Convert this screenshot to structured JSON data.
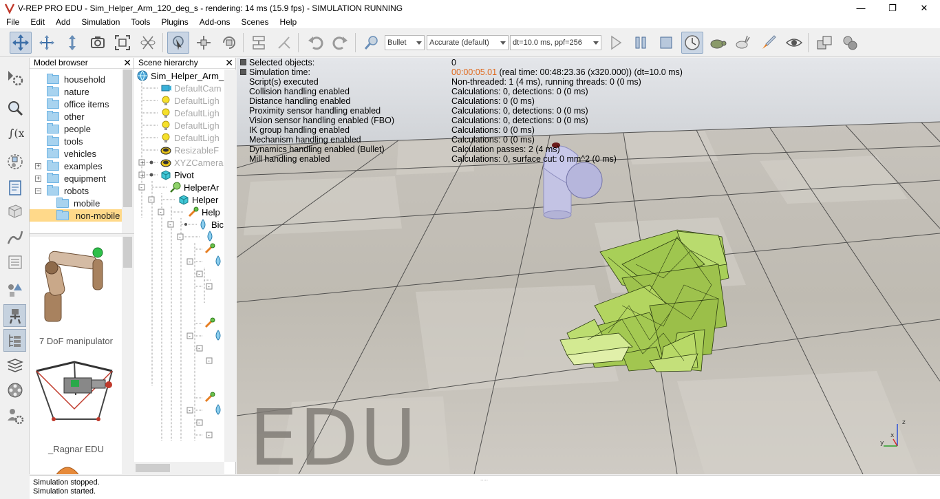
{
  "window": {
    "title": "V-REP PRO EDU - Sim_Helper_Arm_120_deg_s - rendering: 14 ms (15.9 fps) - SIMULATION RUNNING",
    "minimize_glyph": "—",
    "maximize_glyph": "❐",
    "close_glyph": "✕"
  },
  "menu": [
    "File",
    "Edit",
    "Add",
    "Simulation",
    "Tools",
    "Plugins",
    "Add-ons",
    "Scenes",
    "Help"
  ],
  "toolbar": {
    "engine": "Bullet",
    "accuracy": "Accurate (default)",
    "timestep": "dt=10.0 ms, ppf=256",
    "icons": [
      "camera-pan-icon",
      "camera-rotate-icon",
      "camera-shift-icon",
      "camera-angle-icon",
      "fit-to-view-icon",
      "manipulator-mode-icon",
      "click-selection-icon",
      "object-shift-icon",
      "object-rotate-icon",
      "assemble-icon",
      "transfer-dna-icon",
      "undo-icon",
      "redo-icon",
      "dynamic-content-icon",
      "start-simulation-icon",
      "pause-simulation-icon",
      "stop-simulation-icon",
      "real-time-icon",
      "slow-down-icon",
      "speed-up-icon",
      "thread-rendering-icon",
      "visualization-toggle-icon",
      "page-selector-icon",
      "scene-selector-icon"
    ]
  },
  "model_browser": {
    "title": "Model browser",
    "close": "✕",
    "folders": [
      {
        "label": "household",
        "expandable": false
      },
      {
        "label": "nature",
        "expandable": false
      },
      {
        "label": "office items",
        "expandable": false
      },
      {
        "label": "other",
        "expandable": false
      },
      {
        "label": "people",
        "expandable": false
      },
      {
        "label": "tools",
        "expandable": false
      },
      {
        "label": "vehicles",
        "expandable": false
      },
      {
        "label": "examples",
        "expandable": true
      },
      {
        "label": "equipment",
        "expandable": true
      },
      {
        "label": "robots",
        "expandable": true,
        "expanded": true
      },
      {
        "label": "mobile",
        "expandable": false,
        "child": true
      },
      {
        "label": "non-mobile",
        "expandable": false,
        "child": true,
        "selected": true
      }
    ],
    "models": [
      {
        "caption": "7 DoF manipulator"
      },
      {
        "caption": "_Ragnar EDU"
      }
    ]
  },
  "scene_hierarchy": {
    "title": "Scene hierarchy",
    "close": "✕",
    "items": [
      {
        "label": "Sim_Helper_Arm_",
        "icon": "scene-icon",
        "grey": false
      },
      {
        "label": "DefaultCam",
        "icon": "camera-icon",
        "grey": true
      },
      {
        "label": "DefaultLigh",
        "icon": "light-icon",
        "grey": true
      },
      {
        "label": "DefaultLigh",
        "icon": "light-icon",
        "grey": true
      },
      {
        "label": "DefaultLigh",
        "icon": "light-icon",
        "grey": true
      },
      {
        "label": "DefaultLigh",
        "icon": "light-icon",
        "grey": true
      },
      {
        "label": "ResizableF",
        "icon": "model-icon",
        "grey": true
      },
      {
        "label": "XYZCamera",
        "icon": "model-icon",
        "grey": true
      },
      {
        "label": "Pivot",
        "icon": "shape-icon",
        "grey": false
      },
      {
        "label": "HelperAr",
        "icon": "joint-icon",
        "grey": false
      },
      {
        "label": "Helper",
        "icon": "shape-icon",
        "grey": false
      },
      {
        "label": "Help",
        "icon": "force-sensor-icon",
        "grey": false
      },
      {
        "label": "Bic",
        "icon": "dummy-icon",
        "grey": false
      }
    ]
  },
  "sim_info": {
    "rows": [
      {
        "label": "Selected objects:",
        "value": "0"
      },
      {
        "label": "Simulation time:",
        "value_highlight": "00:00:05.01",
        "value": " (real time: 00:48:23.36 (x320.000)) (dt=10.0 ms)"
      },
      {
        "label": "Script(s) executed",
        "value": "Non-threaded: 1 (4 ms), running threads: 0 (0 ms)"
      },
      {
        "label": "Collision handling enabled",
        "value": "Calculations: 0, detections: 0 (0 ms)"
      },
      {
        "label": "Distance handling enabled",
        "value": "Calculations: 0 (0 ms)"
      },
      {
        "label": "Proximity sensor handling enabled",
        "value": "Calculations: 0, detections: 0 (0 ms)"
      },
      {
        "label": "Vision sensor handling enabled (FBO)",
        "value": "Calculations: 0, detections: 0 (0 ms)"
      },
      {
        "label": "IK group handling enabled",
        "value": "Calculations: 0 (0 ms)"
      },
      {
        "label": "Mechanism handling enabled",
        "value": "Calculations: 0 (0 ms)"
      },
      {
        "label": "Dynamics handling enabled (Bullet)",
        "value": "Calculation passes: 2 (4 ms)"
      },
      {
        "label": "Mill handling enabled",
        "value": "Calculations: 0, surface cut: 0 mm^2 (0 ms)"
      }
    ]
  },
  "watermark": "EDU",
  "axes": {
    "x": "x",
    "y": "y",
    "z": "z"
  },
  "status": {
    "lines": [
      "Simulation stopped.",
      "Simulation started."
    ],
    "grip": "....."
  }
}
